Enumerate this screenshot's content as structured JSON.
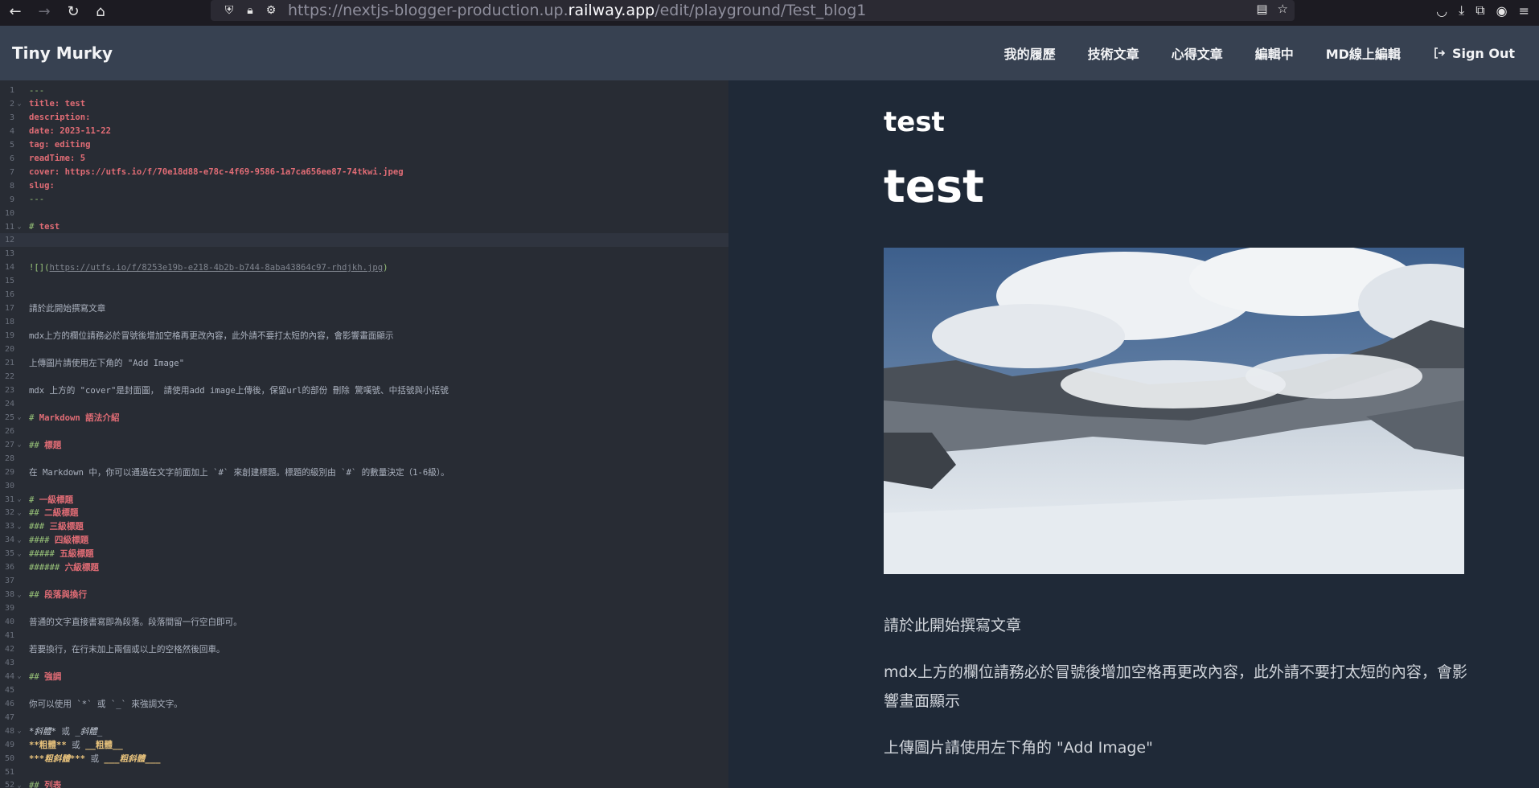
{
  "browser": {
    "url_prefix": "https://nextjs-blogger-production.up.",
    "url_host": "railway.app",
    "url_path": "/edit/playground/Test_blog1"
  },
  "header": {
    "brand": "Tiny Murky",
    "nav": [
      {
        "label": "我的履歷"
      },
      {
        "label": "技術文章"
      },
      {
        "label": "心得文章"
      },
      {
        "label": "編輯中"
      },
      {
        "label": "MD線上編輯"
      },
      {
        "label": "Sign Out"
      }
    ]
  },
  "editor": {
    "active_line": 12,
    "lines": [
      {
        "n": "1",
        "fold": false,
        "segs": [
          {
            "t": "---",
            "c": "c-fm"
          }
        ]
      },
      {
        "n": "2",
        "fold": true,
        "segs": [
          {
            "t": "title: test",
            "c": "c-key"
          }
        ]
      },
      {
        "n": "3",
        "fold": false,
        "segs": [
          {
            "t": "description:",
            "c": "c-key"
          }
        ]
      },
      {
        "n": "4",
        "fold": false,
        "segs": [
          {
            "t": "date: 2023-11-22",
            "c": "c-key"
          }
        ]
      },
      {
        "n": "5",
        "fold": false,
        "segs": [
          {
            "t": "tag: editing",
            "c": "c-key"
          }
        ]
      },
      {
        "n": "6",
        "fold": false,
        "segs": [
          {
            "t": "readTime: 5",
            "c": "c-key"
          }
        ]
      },
      {
        "n": "7",
        "fold": false,
        "segs": [
          {
            "t": "cover: https://utfs.io/f/70e18d88-e78c-4f69-9586-1a7ca656ee87-74tkwi.jpeg",
            "c": "c-key"
          }
        ]
      },
      {
        "n": "8",
        "fold": false,
        "segs": [
          {
            "t": "slug:",
            "c": "c-key"
          }
        ]
      },
      {
        "n": "9",
        "fold": false,
        "segs": [
          {
            "t": "---",
            "c": "c-fm"
          }
        ]
      },
      {
        "n": "10",
        "fold": false,
        "segs": []
      },
      {
        "n": "11",
        "fold": true,
        "segs": [
          {
            "t": "# ",
            "c": "c-hash"
          },
          {
            "t": "test",
            "c": "c-head"
          }
        ]
      },
      {
        "n": "12",
        "fold": false,
        "segs": []
      },
      {
        "n": "13",
        "fold": false,
        "segs": []
      },
      {
        "n": "14",
        "fold": false,
        "segs": [
          {
            "t": "![](",
            "c": "c-lnk"
          },
          {
            "t": "https://utfs.io/f/8253e19b-e218-4b2b-b744-8aba43864c97-rhdjkh.jpg",
            "c": "c-link"
          },
          {
            "t": ")",
            "c": "c-lnk"
          }
        ]
      },
      {
        "n": "15",
        "fold": false,
        "segs": []
      },
      {
        "n": "16",
        "fold": false,
        "segs": []
      },
      {
        "n": "17",
        "fold": false,
        "segs": [
          {
            "t": "請於此開始撰寫文章",
            "c": ""
          }
        ]
      },
      {
        "n": "18",
        "fold": false,
        "segs": []
      },
      {
        "n": "19",
        "fold": false,
        "segs": [
          {
            "t": "mdx上方的欄位請務必於冒號後增加空格再更改內容，此外請不要打太短的內容，會影響畫面顯示",
            "c": ""
          }
        ]
      },
      {
        "n": "20",
        "fold": false,
        "segs": []
      },
      {
        "n": "21",
        "fold": false,
        "segs": [
          {
            "t": "上傳圖片請使用左下角的 \"Add Image\"",
            "c": ""
          }
        ]
      },
      {
        "n": "22",
        "fold": false,
        "segs": []
      },
      {
        "n": "23",
        "fold": false,
        "segs": [
          {
            "t": "mdx 上方的 \"cover\"是封面圖， 請使用add image上傳後，保留url的部份 刪除 驚嘆號、中括號與小括號",
            "c": ""
          }
        ]
      },
      {
        "n": "24",
        "fold": false,
        "segs": []
      },
      {
        "n": "25",
        "fold": true,
        "segs": [
          {
            "t": "# ",
            "c": "c-hash"
          },
          {
            "t": "Markdown 語法介紹",
            "c": "c-head"
          }
        ]
      },
      {
        "n": "26",
        "fold": false,
        "segs": []
      },
      {
        "n": "27",
        "fold": true,
        "segs": [
          {
            "t": "## ",
            "c": "c-hash"
          },
          {
            "t": "標題",
            "c": "c-head"
          }
        ]
      },
      {
        "n": "28",
        "fold": false,
        "segs": []
      },
      {
        "n": "29",
        "fold": false,
        "segs": [
          {
            "t": "在 Markdown 中，你可以通過在文字前面加上 `#` 來創建標題。標題的級別由 `#` 的數量決定（1-6級）。",
            "c": ""
          }
        ]
      },
      {
        "n": "30",
        "fold": false,
        "segs": []
      },
      {
        "n": "31",
        "fold": true,
        "segs": [
          {
            "t": "# ",
            "c": "c-hash"
          },
          {
            "t": "一級標題",
            "c": "c-head"
          }
        ]
      },
      {
        "n": "32",
        "fold": true,
        "segs": [
          {
            "t": "## ",
            "c": "c-hash"
          },
          {
            "t": "二級標題",
            "c": "c-head"
          }
        ]
      },
      {
        "n": "33",
        "fold": true,
        "segs": [
          {
            "t": "### ",
            "c": "c-hash"
          },
          {
            "t": "三級標題",
            "c": "c-head"
          }
        ]
      },
      {
        "n": "34",
        "fold": true,
        "segs": [
          {
            "t": "#### ",
            "c": "c-hash"
          },
          {
            "t": "四級標題",
            "c": "c-head"
          }
        ]
      },
      {
        "n": "35",
        "fold": true,
        "segs": [
          {
            "t": "##### ",
            "c": "c-hash"
          },
          {
            "t": "五級標題",
            "c": "c-head"
          }
        ]
      },
      {
        "n": "36",
        "fold": false,
        "segs": [
          {
            "t": "###### ",
            "c": "c-hash"
          },
          {
            "t": "六級標題",
            "c": "c-head"
          }
        ]
      },
      {
        "n": "37",
        "fold": false,
        "segs": []
      },
      {
        "n": "38",
        "fold": true,
        "segs": [
          {
            "t": "## ",
            "c": "c-hash"
          },
          {
            "t": "段落與換行",
            "c": "c-head"
          }
        ]
      },
      {
        "n": "39",
        "fold": false,
        "segs": []
      },
      {
        "n": "40",
        "fold": false,
        "segs": [
          {
            "t": "普通的文字直接書寫即為段落。段落間留一行空白即可。",
            "c": ""
          }
        ]
      },
      {
        "n": "41",
        "fold": false,
        "segs": []
      },
      {
        "n": "42",
        "fold": false,
        "segs": [
          {
            "t": "若要換行，在行末加上兩個或以上的空格然後回車。",
            "c": ""
          }
        ]
      },
      {
        "n": "43",
        "fold": false,
        "segs": []
      },
      {
        "n": "44",
        "fold": true,
        "segs": [
          {
            "t": "## ",
            "c": "c-hash"
          },
          {
            "t": "強調",
            "c": "c-head"
          }
        ]
      },
      {
        "n": "45",
        "fold": false,
        "segs": []
      },
      {
        "n": "46",
        "fold": false,
        "segs": [
          {
            "t": "你可以使用 `*` 或 `_` 來強調文字。",
            "c": ""
          }
        ]
      },
      {
        "n": "47",
        "fold": false,
        "segs": []
      },
      {
        "n": "48",
        "fold": true,
        "segs": [
          {
            "t": "*斜體*",
            "c": "c-it"
          },
          {
            "t": " 或 ",
            "c": ""
          },
          {
            "t": "_斜體_",
            "c": "c-it"
          }
        ]
      },
      {
        "n": "49",
        "fold": false,
        "segs": [
          {
            "t": "**粗體**",
            "c": "c-bd"
          },
          {
            "t": " 或 ",
            "c": ""
          },
          {
            "t": "__粗體__",
            "c": "c-bd"
          }
        ]
      },
      {
        "n": "50",
        "fold": false,
        "segs": [
          {
            "t": "***粗斜體***",
            "c": "c-bd c-it"
          },
          {
            "t": " 或 ",
            "c": ""
          },
          {
            "t": "___粗斜體___",
            "c": "c-bd c-it"
          }
        ]
      },
      {
        "n": "51",
        "fold": false,
        "segs": []
      },
      {
        "n": "52",
        "fold": true,
        "segs": [
          {
            "t": "## ",
            "c": "c-hash"
          },
          {
            "t": "列表",
            "c": "c-head"
          }
        ]
      }
    ]
  },
  "preview": {
    "title": "test",
    "heading": "test",
    "paragraphs": [
      "請於此開始撰寫文章",
      "mdx上方的欄位請務必於冒號後增加空格再更改內容，此外請不要打太短的內容，會影響畫面顯示",
      "上傳圖片請使用左下角的 \"Add Image\""
    ]
  }
}
